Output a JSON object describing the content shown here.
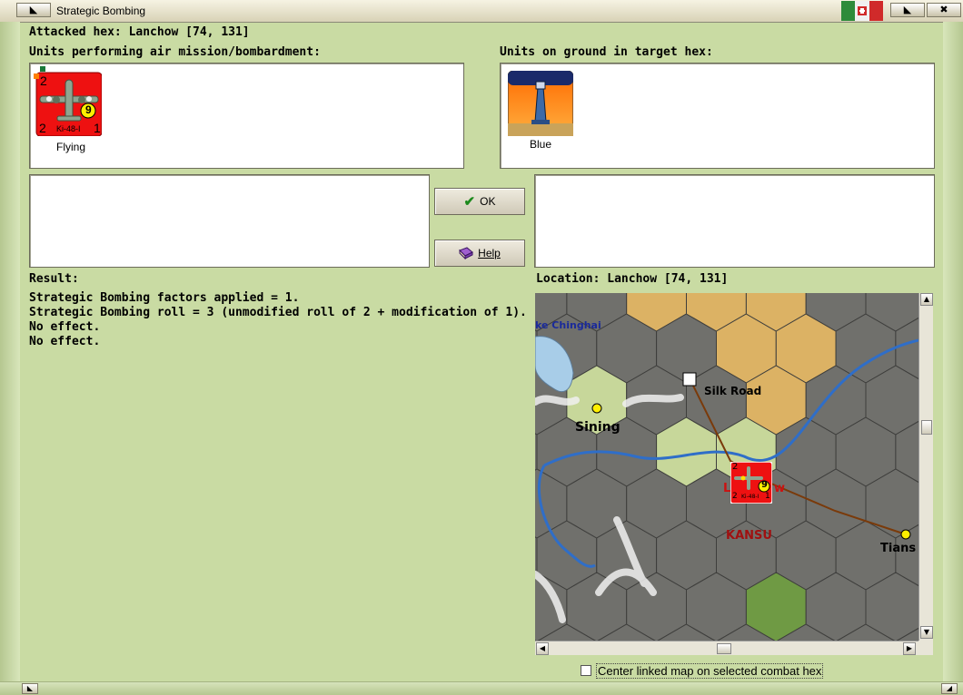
{
  "window": {
    "title": "Strategic Bombing"
  },
  "header": {
    "attacked_hex": "Attacked hex: Lanchow  [74, 131]"
  },
  "air_units": {
    "heading": "Units performing air mission/bombardment:",
    "items": [
      {
        "name": "Ki-48-I",
        "status": "Flying",
        "top_left": "2",
        "bottom_left": "2",
        "bottom_right": "1",
        "badge": "9"
      }
    ]
  },
  "ground_units": {
    "heading": "Units on ground in target hex:",
    "items": [
      {
        "status": "Blue"
      }
    ]
  },
  "buttons": {
    "ok": "OK",
    "help": "Help"
  },
  "result": {
    "heading": "Result:",
    "lines": [
      "Strategic Bombing factors applied = 1.",
      "Strategic Bombing roll = 3 (unmodified roll of 2 + modification of 1).",
      "No effect.",
      "No effect."
    ]
  },
  "location": {
    "heading": "Location:  Lanchow  [74, 131]",
    "map_labels": {
      "lake": "ke Chinghai",
      "silk_road": "Silk Road",
      "sining": "Sining",
      "kansu": "KANSU",
      "tians": "Tians",
      "lanchow_partial": "L",
      "lanchow_partial2": "w"
    },
    "map_unit": {
      "name": "Ki-48-I",
      "badge": "9",
      "top_left": "2",
      "bottom_left": "2",
      "bottom_right": "1"
    }
  },
  "options": {
    "center_map_label": "Center linked map on selected combat hex",
    "center_map_checked": false
  },
  "colors": {
    "background": "#c9dba3",
    "unit_red": "#ee1111",
    "badge_yellow": "#ffef00"
  }
}
